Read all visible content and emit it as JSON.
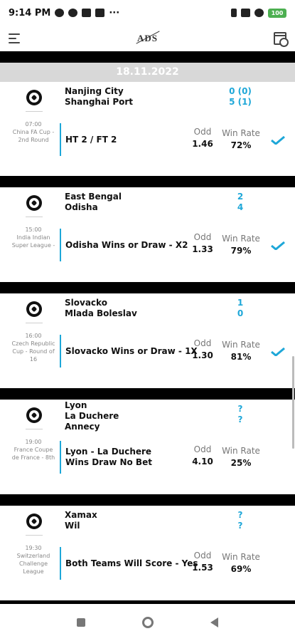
{
  "status_bar": {
    "time": "9:14 PM",
    "battery": "100"
  },
  "header": {
    "logo": "ADS",
    "menu_icon": "menu-icon",
    "calendar_icon": "calendar-icon"
  },
  "date": "18.11.2022",
  "labels": {
    "odd": "Odd",
    "win_rate": "Win Rate"
  },
  "matches": [
    {
      "teams": [
        "Nanjing City",
        "Shanghai Port"
      ],
      "scores": [
        "0 (0)",
        "5 (1)"
      ],
      "time": "07:00",
      "league": "China FA Cup - 2nd Round",
      "pick": "HT 2 / FT 2",
      "odd": "1.46",
      "win_rate": "72%",
      "won": true
    },
    {
      "teams": [
        "East Bengal",
        "Odisha"
      ],
      "scores": [
        "2",
        "4"
      ],
      "time": "15:00",
      "league": "India Indian Super League -",
      "pick": "Odisha Wins or Draw - X2",
      "odd": "1.33",
      "win_rate": "79%",
      "won": true
    },
    {
      "teams": [
        "Slovacko",
        "Mlada Boleslav"
      ],
      "scores": [
        "1",
        "0"
      ],
      "time": "16:00",
      "league": "Czech Republic Cup - Round of 16",
      "pick": "Slovacko Wins or Draw - 1X",
      "odd": "1.30",
      "win_rate": "81%",
      "won": true
    },
    {
      "teams": [
        "Lyon",
        "La Duchere",
        "Annecy"
      ],
      "scores": [
        "?",
        "?"
      ],
      "time": "19:00",
      "league": "France Coupe de France - 8th",
      "pick": "Lyon - La Duchere Wins Draw No Bet",
      "odd": "4.10",
      "win_rate": "25%",
      "won": false
    },
    {
      "teams": [
        "Xamax",
        "Wil"
      ],
      "scores": [
        "?",
        "?"
      ],
      "time": "19:30",
      "league": "Switzerland Challenge League",
      "pick": "Both Teams Will Score - Yes",
      "odd": "1.53",
      "win_rate": "69%",
      "won": false
    }
  ],
  "colors": {
    "accent": "#1ea7d8",
    "bar": "#000000",
    "date_bg": "#d8d8d8"
  }
}
